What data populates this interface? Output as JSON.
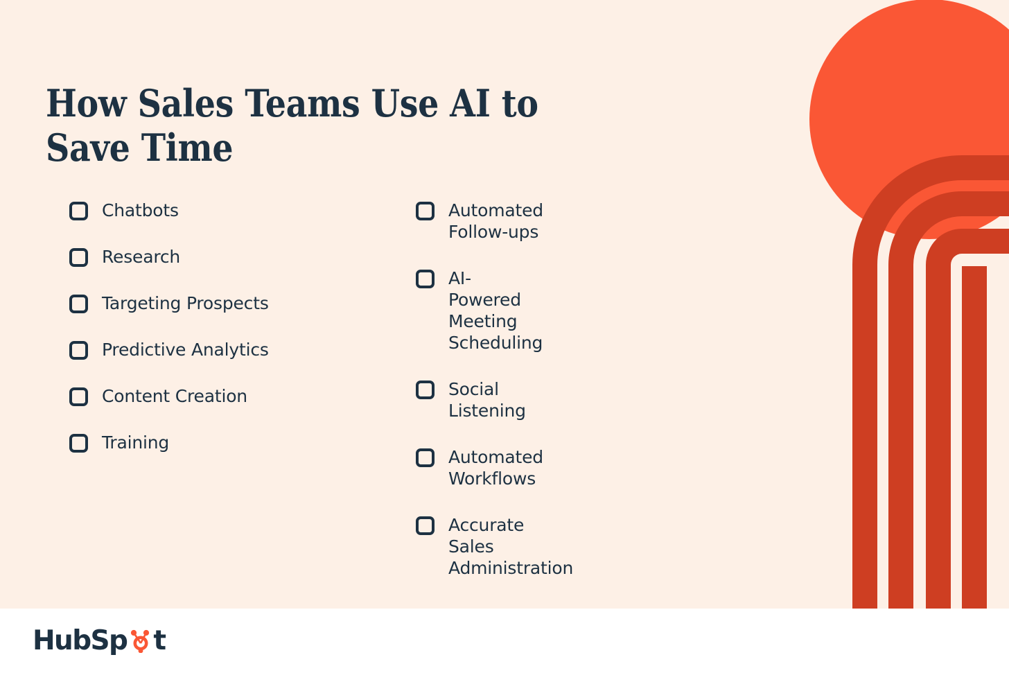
{
  "theme": {
    "background_cream": "#FDF0E6",
    "footer_white": "#FFFFFF",
    "navy": "#1D3142",
    "orange_bright": "#FA5735",
    "orange_dark": "#CE3E22"
  },
  "header": {
    "title_line1": "How Sales Teams Use AI to",
    "title_line2": "Save Time",
    "title_full": "How Sales Teams Use AI to Save Time"
  },
  "checklist": {
    "left_column": [
      {
        "label": "Chatbots",
        "checked": false
      },
      {
        "label": "Research",
        "checked": false
      },
      {
        "label": "Targeting Prospects",
        "checked": false
      },
      {
        "label": "Predictive Analytics",
        "checked": false
      },
      {
        "label": "Content Creation",
        "checked": false
      },
      {
        "label": "Training",
        "checked": false
      }
    ],
    "right_column": [
      {
        "label": "Automated Follow-ups",
        "checked": false
      },
      {
        "label": "AI-Powered Meeting\nScheduling",
        "checked": false
      },
      {
        "label": "Social Listening",
        "checked": false
      },
      {
        "label": "Automated Workflows",
        "checked": false
      },
      {
        "label": "Accurate Sales\nAdministration",
        "checked": false
      }
    ]
  },
  "decoration": {
    "circle_icon": "orange-circle",
    "arcs_icon": "concentric-arches",
    "arc_count": 4
  },
  "footer": {
    "brand_prefix": "HubSp",
    "brand_suffix": "t",
    "brand_full": "HubSpot",
    "logo_mark_icon": "hubspot-sprocket-icon"
  }
}
